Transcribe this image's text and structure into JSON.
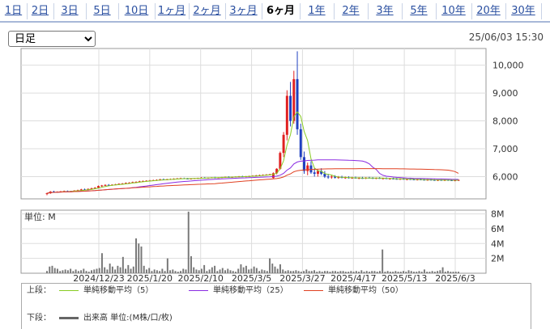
{
  "tabs": [
    {
      "label": "1日",
      "active": false
    },
    {
      "label": "2日",
      "active": false
    },
    {
      "label": "3日",
      "active": false
    },
    {
      "label": "5日",
      "active": false
    },
    {
      "label": "10日",
      "active": false
    },
    {
      "label": "1ヶ月",
      "active": false
    },
    {
      "label": "2ヶ月",
      "active": false
    },
    {
      "label": "3ヶ月",
      "active": false
    },
    {
      "label": "6ヶ月",
      "active": true
    },
    {
      "label": "1年",
      "active": false
    },
    {
      "label": "2年",
      "active": false
    },
    {
      "label": "3年",
      "active": false
    },
    {
      "label": "5年",
      "active": false
    },
    {
      "label": "10年",
      "active": false
    },
    {
      "label": "20年",
      "active": false
    },
    {
      "label": "30年",
      "active": false
    }
  ],
  "range_select": {
    "value": "日足"
  },
  "timestamp": "25/06/03 15:30",
  "legend": {
    "upper_label": "上段：",
    "lower_label": "下段：",
    "items": [
      {
        "name": "単純移動平均（5）",
        "color": "#88cc22"
      },
      {
        "name": "単純移動平均（25）",
        "color": "#8a2be2"
      },
      {
        "name": "単純移動平均（50）",
        "color": "#e04020"
      }
    ],
    "volume_item": {
      "name": "出来高 単位:(M株/口/枚)",
      "color": "#666666"
    }
  },
  "chart_data": {
    "type": "candlestick",
    "x_ticks": [
      "2024/12/23",
      "2025/1/20",
      "2025/2/10",
      "2025/3/5",
      "2025/3/27",
      "2025/4/17",
      "2025/5/13",
      "2025/6/3"
    ],
    "price_axis": {
      "ticks": [
        "6,000",
        "7,000",
        "8,000",
        "9,000",
        "10,000"
      ],
      "ylim": [
        5200,
        10600
      ]
    },
    "volume_axis": {
      "unit_label": "単位: M",
      "ticks": [
        "2M",
        "4M",
        "6M",
        "8M"
      ],
      "ylim": [
        0,
        8.5
      ]
    },
    "colors": {
      "up": "#e02020",
      "down": "#2040c0",
      "volume": "#777777"
    },
    "candles": [
      [
        5380,
        5420,
        5330,
        5400
      ],
      [
        5400,
        5480,
        5380,
        5460
      ],
      [
        5460,
        5490,
        5420,
        5440
      ],
      [
        5440,
        5470,
        5420,
        5450
      ],
      [
        5450,
        5480,
        5430,
        5470
      ],
      [
        5470,
        5500,
        5450,
        5480
      ],
      [
        5480,
        5500,
        5450,
        5460
      ],
      [
        5460,
        5490,
        5440,
        5480
      ],
      [
        5480,
        5510,
        5460,
        5500
      ],
      [
        5500,
        5530,
        5480,
        5510
      ],
      [
        5510,
        5560,
        5490,
        5540
      ],
      [
        5540,
        5570,
        5510,
        5530
      ],
      [
        5530,
        5570,
        5510,
        5560
      ],
      [
        5560,
        5600,
        5540,
        5580
      ],
      [
        5580,
        5620,
        5560,
        5600
      ],
      [
        5600,
        5680,
        5580,
        5660
      ],
      [
        5660,
        5700,
        5630,
        5680
      ],
      [
        5680,
        5720,
        5660,
        5700
      ],
      [
        5700,
        5730,
        5670,
        5690
      ],
      [
        5690,
        5720,
        5670,
        5710
      ],
      [
        5710,
        5740,
        5690,
        5720
      ],
      [
        5720,
        5760,
        5700,
        5740
      ],
      [
        5740,
        5770,
        5720,
        5750
      ],
      [
        5750,
        5790,
        5730,
        5770
      ],
      [
        5770,
        5800,
        5750,
        5780
      ],
      [
        5780,
        5820,
        5760,
        5800
      ],
      [
        5800,
        5830,
        5780,
        5810
      ],
      [
        5810,
        5850,
        5790,
        5830
      ],
      [
        5830,
        5860,
        5810,
        5840
      ],
      [
        5840,
        5870,
        5820,
        5850
      ],
      [
        5850,
        5880,
        5830,
        5860
      ],
      [
        5860,
        5890,
        5840,
        5870
      ],
      [
        5870,
        5900,
        5850,
        5880
      ],
      [
        5880,
        5920,
        5860,
        5900
      ],
      [
        5900,
        5930,
        5870,
        5890
      ],
      [
        5890,
        5920,
        5870,
        5900
      ],
      [
        5900,
        5930,
        5880,
        5910
      ],
      [
        5910,
        5940,
        5890,
        5920
      ],
      [
        5920,
        5950,
        5900,
        5930
      ],
      [
        5930,
        5960,
        5910,
        5940
      ],
      [
        5940,
        5960,
        5910,
        5930
      ],
      [
        5930,
        5950,
        5910,
        5920
      ],
      [
        5920,
        5940,
        5900,
        5930
      ],
      [
        5930,
        5950,
        5910,
        5940
      ],
      [
        5940,
        5960,
        5920,
        5950
      ],
      [
        5950,
        5980,
        5930,
        5960
      ],
      [
        5960,
        5980,
        5940,
        5950
      ],
      [
        5950,
        5970,
        5930,
        5960
      ],
      [
        5960,
        5980,
        5940,
        5970
      ],
      [
        5970,
        5990,
        5950,
        5960
      ],
      [
        5960,
        5980,
        5940,
        5970
      ],
      [
        5970,
        5990,
        5950,
        5980
      ],
      [
        5980,
        6000,
        5960,
        5990
      ],
      [
        5990,
        6010,
        5970,
        5980
      ],
      [
        5980,
        6000,
        5960,
        5990
      ],
      [
        5990,
        6010,
        5970,
        6000
      ],
      [
        6000,
        6020,
        5980,
        6010
      ],
      [
        6010,
        6030,
        5990,
        6000
      ],
      [
        6000,
        6020,
        5980,
        6010
      ],
      [
        6010,
        6030,
        5990,
        6020
      ],
      [
        6020,
        6050,
        6000,
        6030
      ],
      [
        6030,
        6060,
        6010,
        6040
      ],
      [
        6040,
        6070,
        6020,
        6050
      ],
      [
        6050,
        6080,
        6030,
        6060
      ],
      [
        6060,
        6090,
        6040,
        6070
      ],
      [
        6070,
        6100,
        6050,
        6080
      ],
      [
        5950,
        6150,
        5930,
        6120
      ],
      [
        6120,
        6300,
        6080,
        6280
      ],
      [
        6280,
        6900,
        6250,
        6850
      ],
      [
        6850,
        7600,
        6700,
        7500
      ],
      [
        7500,
        9100,
        7300,
        8900
      ],
      [
        8900,
        9400,
        7800,
        8000
      ],
      [
        8000,
        9800,
        7900,
        9500
      ],
      [
        9500,
        10500,
        7500,
        7700
      ],
      [
        7700,
        7900,
        6600,
        6700
      ],
      [
        6700,
        6900,
        6100,
        6200
      ],
      [
        6200,
        6500,
        6050,
        6400
      ],
      [
        6400,
        6550,
        6100,
        6150
      ],
      [
        6150,
        6300,
        6000,
        6100
      ],
      [
        6100,
        6250,
        6000,
        6200
      ],
      [
        6200,
        6300,
        6050,
        6100
      ],
      [
        6100,
        6200,
        5950,
        6000
      ],
      [
        6000,
        6100,
        5920,
        5980
      ],
      [
        5980,
        6050,
        5920,
        6000
      ],
      [
        6000,
        6050,
        5930,
        5960
      ],
      [
        5960,
        6020,
        5920,
        5980
      ],
      [
        5980,
        6030,
        5940,
        5950
      ],
      [
        5950,
        6000,
        5920,
        5970
      ],
      [
        5970,
        6010,
        5930,
        5950
      ],
      [
        5950,
        5990,
        5920,
        5960
      ],
      [
        5960,
        6000,
        5930,
        5940
      ],
      [
        5940,
        5980,
        5910,
        5950
      ],
      [
        5950,
        5990,
        5920,
        5940
      ],
      [
        5940,
        5980,
        5910,
        5960
      ],
      [
        5960,
        5990,
        5930,
        5950
      ],
      [
        5950,
        5980,
        5920,
        5940
      ],
      [
        5940,
        5970,
        5910,
        5950
      ],
      [
        5950,
        5980,
        5920,
        5930
      ],
      [
        5930,
        5960,
        5900,
        5940
      ],
      [
        5940,
        5970,
        5910,
        5920
      ],
      [
        5920,
        5950,
        5890,
        5930
      ],
      [
        5930,
        5960,
        5900,
        5920
      ],
      [
        5920,
        5950,
        5890,
        5910
      ],
      [
        5910,
        5940,
        5880,
        5920
      ],
      [
        5920,
        5950,
        5890,
        5900
      ],
      [
        5900,
        5930,
        5870,
        5910
      ],
      [
        5910,
        5940,
        5880,
        5900
      ],
      [
        5900,
        5930,
        5870,
        5890
      ],
      [
        5890,
        5920,
        5860,
        5900
      ],
      [
        5900,
        5930,
        5870,
        5890
      ],
      [
        5890,
        5920,
        5860,
        5880
      ],
      [
        5880,
        5910,
        5850,
        5890
      ],
      [
        5890,
        5920,
        5860,
        5880
      ],
      [
        5880,
        5910,
        5850,
        5870
      ],
      [
        5870,
        5900,
        5840,
        5880
      ],
      [
        5880,
        5910,
        5850,
        5870
      ],
      [
        5870,
        5900,
        5840,
        5880
      ],
      [
        5880,
        5910,
        5850,
        5870
      ],
      [
        5870,
        5900,
        5840,
        5860
      ],
      [
        5860,
        5890,
        5830,
        5870
      ],
      [
        5870,
        5900,
        5840,
        5880
      ]
    ],
    "volume": [
      0.3,
      0.9,
      1.0,
      0.7,
      0.6,
      0.3,
      0.4,
      0.5,
      0.4,
      0.6,
      0.3,
      0.5,
      0.3,
      0.4,
      0.6,
      0.3,
      0.2,
      0.4,
      0.5,
      0.6,
      0.7,
      2.7,
      0.8,
      0.5,
      1.3,
      0.9,
      0.5,
      1.0,
      0.8,
      2.2,
      0.6,
      1.1,
      0.6,
      0.9,
      4.7,
      4.0,
      3.6,
      1.0,
      0.5,
      0.7,
      0.3,
      0.5,
      0.4,
      0.3,
      0.6,
      0.3,
      2.0,
      0.4,
      0.5,
      0.3,
      0.2,
      0.3,
      0.6,
      0.5,
      8.3,
      2.3,
      0.8,
      0.5,
      0.4,
      0.6,
      1.1,
      0.3,
      0.5,
      0.8,
      1.0,
      0.3,
      0.5,
      0.7,
      0.4,
      0.6,
      0.4,
      0.3,
      0.2,
      0.6,
      1.2,
      0.8,
      1.0,
      0.5,
      0.6,
      0.9,
      0.7,
      0.3,
      0.5,
      0.4,
      0.3,
      2.0,
      1.3,
      0.9,
      0.6,
      1.2,
      0.5,
      0.3,
      0.4,
      0.3,
      0.3,
      0.4,
      0.3,
      0.2,
      0.3,
      0.5,
      0.3,
      0.3,
      0.4,
      0.2,
      0.3,
      0.2,
      0.3,
      0.3,
      0.2,
      0.3,
      0.3,
      0.2,
      0.3,
      0.3,
      0.2,
      0.2,
      0.3,
      0.2,
      0.3,
      0.2,
      0.4,
      0.2,
      0.3,
      0.2,
      0.3,
      0.3,
      0.2,
      0.3,
      3.2,
      0.2,
      0.3,
      0.2,
      0.2,
      0.3,
      0.2,
      0.2,
      0.3,
      0.2,
      0.4,
      0.3,
      0.2,
      0.2,
      0.3,
      0.2,
      0.5,
      0.2,
      0.2,
      0.3,
      0.2,
      0.3,
      0.4,
      0.8,
      0.2,
      0.3,
      0.2,
      0.2,
      0.2,
      0.2
    ]
  }
}
